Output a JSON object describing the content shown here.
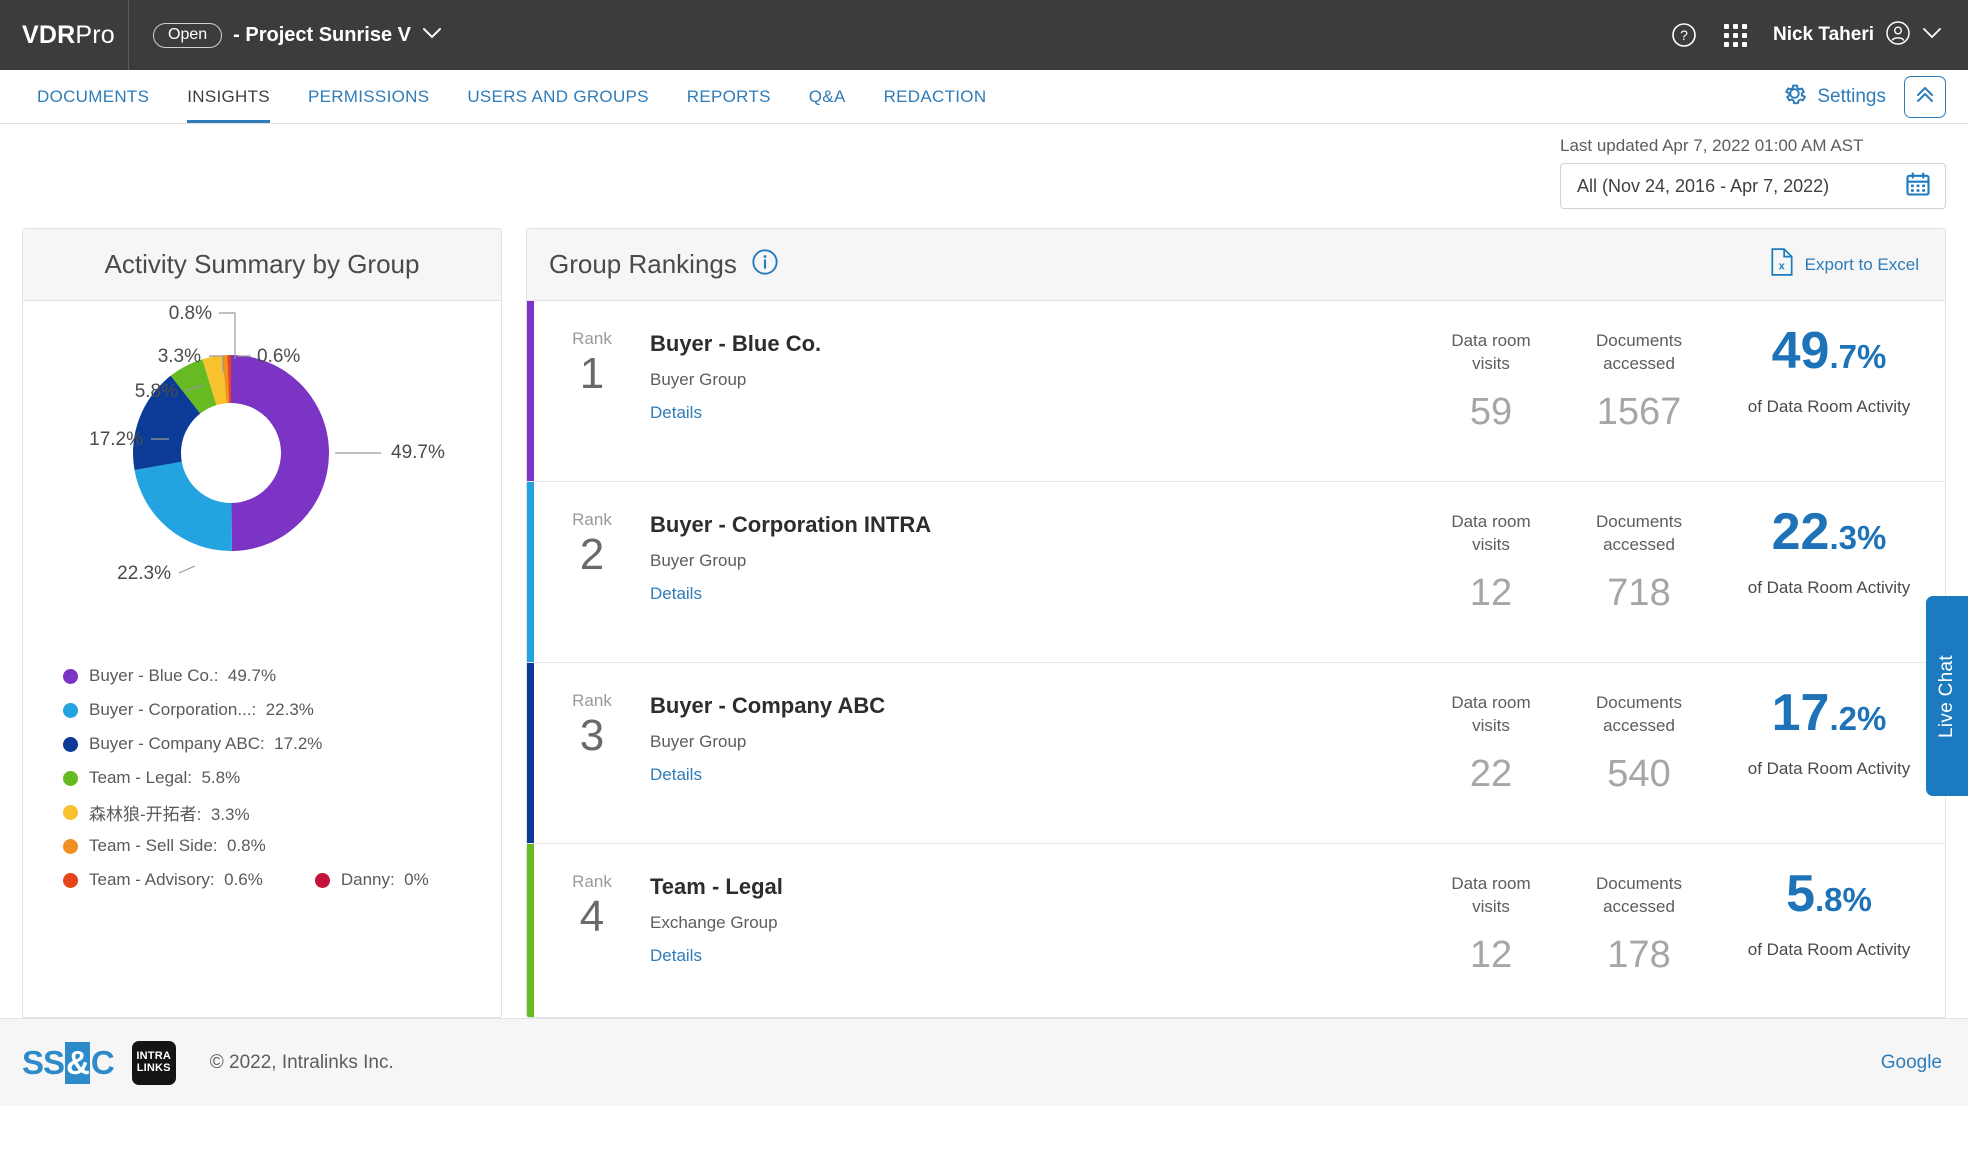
{
  "topbar": {
    "brand_bold": "VDR",
    "brand_light": "Pro",
    "status_pill": "Open",
    "room_name": "- Project Sunrise V",
    "chevron": "⌄",
    "help_icon": "help-icon",
    "apps_icon": "apps-grid-icon",
    "user_name": "Nick Taheri"
  },
  "nav": {
    "tabs": [
      {
        "label": "DOCUMENTS",
        "active": false
      },
      {
        "label": "INSIGHTS",
        "active": true
      },
      {
        "label": "PERMISSIONS",
        "active": false
      },
      {
        "label": "USERS AND GROUPS",
        "active": false
      },
      {
        "label": "REPORTS",
        "active": false
      },
      {
        "label": "Q&A",
        "active": false
      },
      {
        "label": "REDACTION",
        "active": false
      }
    ],
    "settings_label": "Settings",
    "collapse_icon": "chevron-up-double-icon"
  },
  "filter": {
    "last_updated": "Last updated Apr 7, 2022 01:00 AM AST",
    "date_range": "All (Nov 24, 2016 - Apr 7, 2022)",
    "calendar_icon": "calendar-icon"
  },
  "activity_panel": {
    "title": "Activity Summary by Group"
  },
  "chart_data": {
    "type": "pie",
    "title": "Activity Summary by Group",
    "subtype": "donut",
    "legend_position": "bottom-left",
    "labels": [
      "Buyer - Blue Co.",
      "Buyer - Corporation...",
      "Buyer - Company ABC",
      "Team - Legal",
      "森林狼-开拓者",
      "Team - Sell Side",
      "Team - Advisory",
      "Danny"
    ],
    "values": [
      49.7,
      22.3,
      17.2,
      5.8,
      3.3,
      0.8,
      0.6,
      0
    ],
    "value_labels": [
      "49.7%",
      "22.3%",
      "17.2%",
      "5.8%",
      "3.3%",
      "0.8%",
      "0.6%",
      "0%"
    ],
    "colors": [
      "#7b34c4",
      "#23a3e0",
      "#0b3b96",
      "#66bb23",
      "#f7c22e",
      "#f09020",
      "#e8441a",
      "#c4123b"
    ],
    "legend_entries": [
      {
        "label": "Buyer - Blue Co.:",
        "value": "49.7%",
        "color": "#7b34c4"
      },
      {
        "label": "Buyer - Corporation...:",
        "value": "22.3%",
        "color": "#23a3e0"
      },
      {
        "label": "Buyer - Company ABC:",
        "value": "17.2%",
        "color": "#0b3b96"
      },
      {
        "label": "Team - Legal:",
        "value": "5.8%",
        "color": "#66bb23"
      },
      {
        "label": "森林狼-开拓者:",
        "value": "3.3%",
        "color": "#f7c22e"
      },
      {
        "label": "Team - Sell Side:",
        "value": "0.8%",
        "color": "#f09020"
      },
      {
        "label": "Team - Advisory:",
        "value": "0.6%",
        "color": "#e8441a"
      }
    ],
    "legend_extra": {
      "label": "Danny:",
      "value": "0%",
      "color": "#c4123b"
    }
  },
  "rankings": {
    "title": "Group Rankings",
    "info_icon": "info-circle-icon",
    "export_label": "Export to Excel",
    "export_icon": "excel-file-icon",
    "rank_word": "Rank",
    "metric1_label_line1": "Data room",
    "metric1_label_line2": "visits",
    "metric2_label_line1": "Documents",
    "metric2_label_line2": "accessed",
    "pct_sub": "of Data Room Activity",
    "details_label": "Details",
    "rows": [
      {
        "rank": "1",
        "name": "Buyer - Blue Co.",
        "group_type": "Buyer Group",
        "visits": "59",
        "documents": "1567",
        "pct_whole": "49",
        "pct_frac": ".7%",
        "color": "#7b34c4"
      },
      {
        "rank": "2",
        "name": "Buyer - Corporation INTRA",
        "group_type": "Buyer Group",
        "visits": "12",
        "documents": "718",
        "pct_whole": "22",
        "pct_frac": ".3%",
        "color": "#23a3e0"
      },
      {
        "rank": "3",
        "name": "Buyer - Company ABC",
        "group_type": "Buyer Group",
        "visits": "22",
        "documents": "540",
        "pct_whole": "17",
        "pct_frac": ".2%",
        "color": "#0b3b96"
      },
      {
        "rank": "4",
        "name": "Team - Legal",
        "group_type": "Exchange Group",
        "visits": "12",
        "documents": "178",
        "pct_whole": "5",
        "pct_frac": ".8%",
        "color": "#66bb23"
      }
    ]
  },
  "live_chat": {
    "label": "Live Chat"
  },
  "footer": {
    "ssc_left": "SS",
    "ssc_amp": "&",
    "ssc_right": "C",
    "intralinks_line1": "INTRA",
    "intralinks_line2": "LINKS",
    "copyright": "© 2022, Intralinks Inc.",
    "google_label": "Google"
  }
}
